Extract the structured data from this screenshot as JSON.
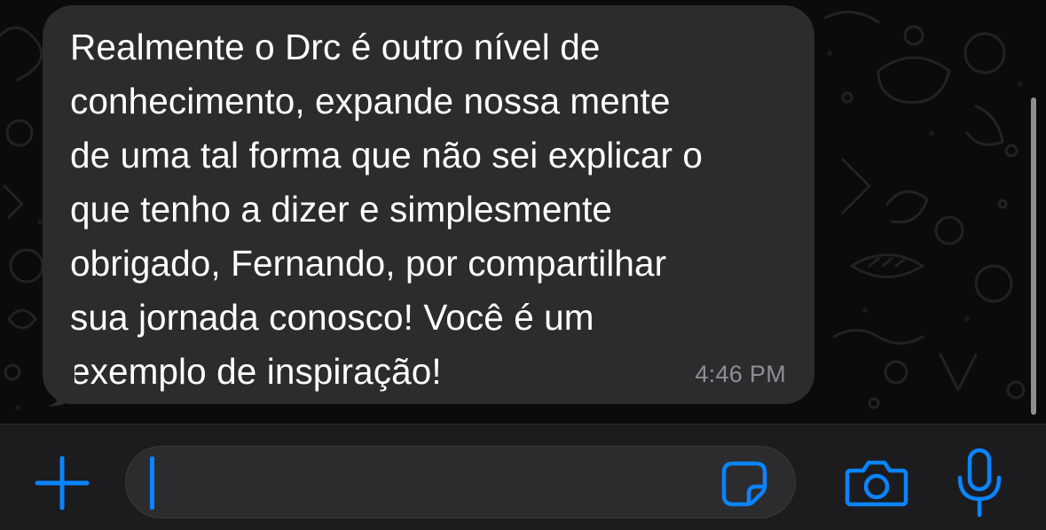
{
  "message": {
    "text": "Realmente o Drc é outro nível de\nconhecimento, expande nossa mente\nde uma tal forma que não sei explicar o\nque tenho a dizer e simplesmente\nobrigado, Fernando, por compartilhar\nsua jornada conosco! Você é um\nexemplo de inspiração!",
    "time": "4:46 PM",
    "direction": "incoming"
  },
  "composer": {
    "input_value": "",
    "left_icon": "plus-icon",
    "field_icon": "sticker-icon",
    "right_icons": [
      "camera-icon",
      "microphone-icon"
    ]
  },
  "colors": {
    "background": "#0b0b0b",
    "bubble": "#2c2c2e",
    "message_text": "#ffffff",
    "timestamp": "#8e8e93",
    "accent": "#0a84ff",
    "toolbar": "#1c1c1e"
  }
}
